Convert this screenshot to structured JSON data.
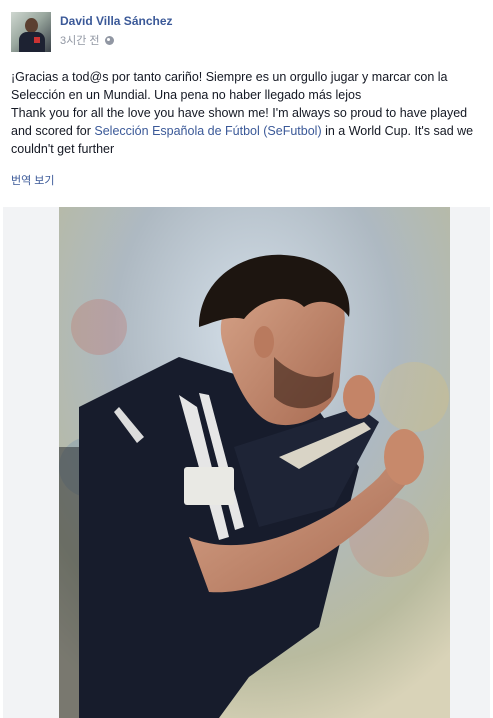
{
  "post": {
    "author": "David Villa Sánchez",
    "timestamp": "3시간 전",
    "privacy_icon": "globe-icon",
    "text_es": "¡Gracias a tod@s por tanto cariño! Siempre es un orgullo jugar y marcar con la Selección en un Mundial. Una pena no haber llegado más lejos",
    "text_en_before": "Thank you for all the love you have shown me! I'm always so proud to have played and scored for ",
    "text_en_link": "Selección Española de Fútbol (SeFutbol)",
    "text_en_after": " in a World Cup. It's sad we couldn't get further",
    "translate_label": "번역 보기"
  },
  "colors": {
    "link": "#3b5998",
    "meta": "#9197a3",
    "text": "#141823",
    "photo_frame": "#f2f3f5"
  }
}
